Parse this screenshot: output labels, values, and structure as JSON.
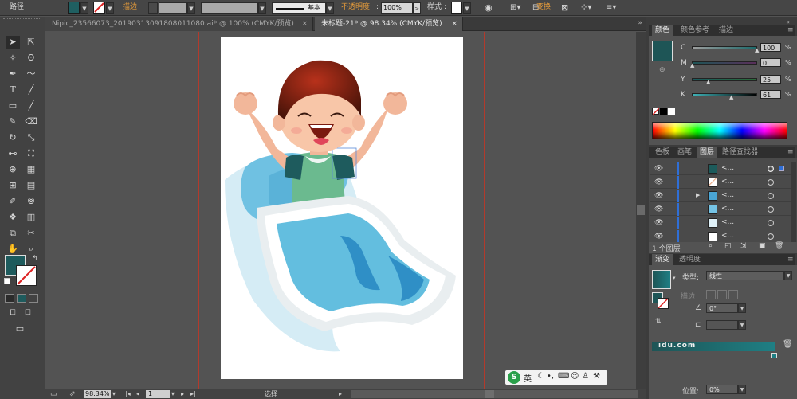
{
  "control_bar": {
    "object_type": "路径",
    "stroke_label": "描边",
    "stroke_style": "基本",
    "opacity_label": "不透明度",
    "opacity_value": "100%",
    "style_label": "样式",
    "transform_label": "变换",
    "fill_color": "#1f5f61",
    "accent": "#e39a3b"
  },
  "tabs": [
    {
      "label": "Nipic_23566073_20190313091808011080.ai* @ 100% (CMYK/预览)",
      "close": "×"
    },
    {
      "label": "未标题-21* @ 98.34% (CMYK/预览)",
      "close": "×"
    }
  ],
  "status_bar": {
    "zoom": "98.34%",
    "page": "1",
    "tool_name": "选择"
  },
  "color_panel": {
    "tabs": [
      "颜色",
      "颜色参考",
      "描边"
    ],
    "swatch": "#1e5556",
    "channels": [
      {
        "label": "C",
        "value": "100",
        "level": 1.0
      },
      {
        "label": "M",
        "value": "0",
        "level": 0.0
      },
      {
        "label": "Y",
        "value": "25",
        "level": 0.25
      },
      {
        "label": "K",
        "value": "61",
        "level": 0.61
      }
    ]
  },
  "layers_panel": {
    "tabs": [
      "色板",
      "画笔",
      "图层",
      "路径查找器"
    ],
    "rows": [
      {
        "name": "<...",
        "thumb": "#1d5b5b"
      },
      {
        "name": "<...",
        "thumb": "#e6a07a"
      },
      {
        "name": "<...",
        "thumb": "#4aa6d6"
      },
      {
        "name": "<...",
        "thumb": "#75c4e6"
      },
      {
        "name": "<...",
        "thumb": "#ffffff"
      },
      {
        "name": "<...",
        "thumb": "#ffffff"
      }
    ],
    "footer": "1 个图层"
  },
  "gradient_panel": {
    "tabs": [
      "渐变",
      "透明度"
    ],
    "type_label": "类型:",
    "type_value": "线性",
    "stroke_label": "描边",
    "angle_value": "0°",
    "location_label": "位置:",
    "location_value": "0%",
    "gradient_from": "#1e5556",
    "gradient_to": "#1f7f84"
  },
  "ime_bar": {
    "badge": "S",
    "lang": "英"
  },
  "watermark": "ıdu.com"
}
